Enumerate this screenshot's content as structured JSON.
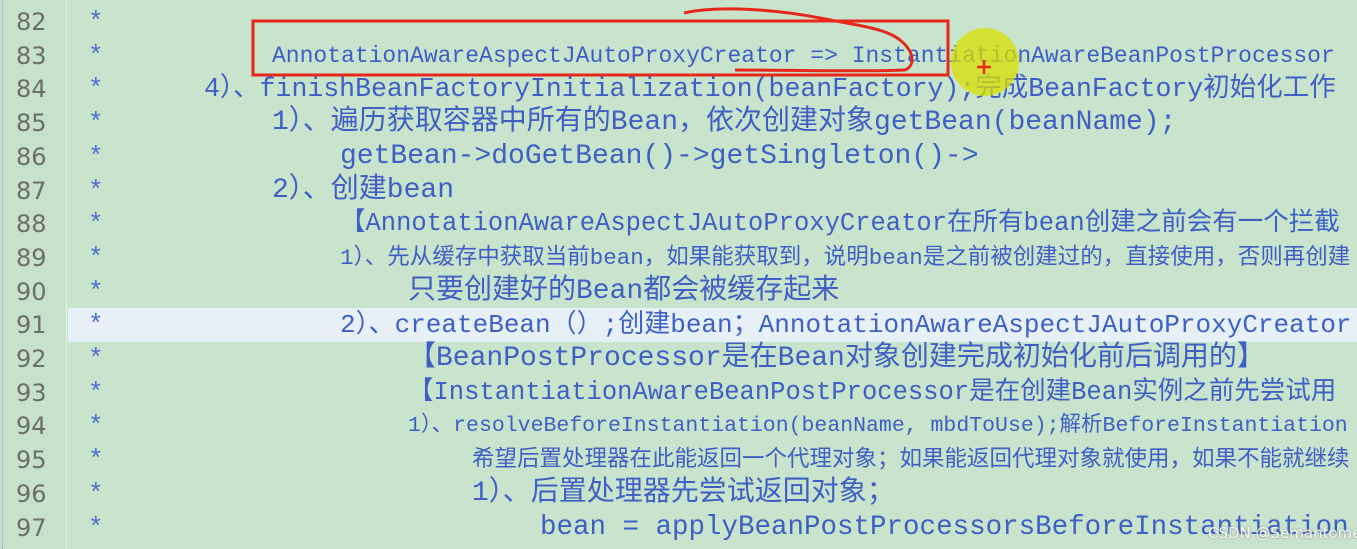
{
  "editor": {
    "lines": [
      {
        "number": "82",
        "text": ""
      },
      {
        "number": "83",
        "text": "AnnotationAwareAspectJAutoProxyCreator => InstantiationAwareBeanPostProcessor"
      },
      {
        "number": "84",
        "text": "4）、finishBeanFactoryInitialization(beanFactory);完成BeanFactory初始化工作"
      },
      {
        "number": "85",
        "text": "1）、遍历获取容器中所有的Bean，依次创建对象getBean(beanName);"
      },
      {
        "number": "86",
        "text": "getBean->doGetBean()->getSingleton()->"
      },
      {
        "number": "87",
        "text": "2）、创建bean"
      },
      {
        "number": "88",
        "text": "【AnnotationAwareAspectJAutoProxyCreator在所有bean创建之前会有一个拦截"
      },
      {
        "number": "89",
        "text": "1）、先从缓存中获取当前bean，如果能获取到，说明bean是之前被创建过的，直接使用，否则再创建"
      },
      {
        "number": "90",
        "text": "只要创建好的Bean都会被缓存起来"
      },
      {
        "number": "91",
        "text": "2）、createBean（）;创建bean；AnnotationAwareAspectJAutoProxyCreator"
      },
      {
        "number": "92",
        "text": "【BeanPostProcessor是在Bean对象创建完成初始化前后调用的】"
      },
      {
        "number": "93",
        "text": "【InstantiationAwareBeanPostProcessor是在创建Bean实例之前先尝试用"
      },
      {
        "number": "94",
        "text": "1）、resolveBeforeInstantiation(beanName, mbdToUse);解析BeforeInstantiation"
      },
      {
        "number": "95",
        "text": "希望后置处理器在此能返回一个代理对象；如果能返回代理对象就使用，如果不能就继续"
      },
      {
        "number": "96",
        "text": "1）、后置处理器先尝试返回对象；"
      },
      {
        "number": "97",
        "text": "bean = applyBeanPostProcessorsBeforeInstantiation"
      }
    ],
    "comment_marker": "*",
    "current_line": "91"
  },
  "watermark": "CSDN @Semantome",
  "colors": {
    "background": "#c8e4cc",
    "current_line": "#e6f0f6",
    "comment_text": "#3f5fc4",
    "annotation_red": "#e8281c",
    "cursor_highlight": "#d8e000"
  }
}
